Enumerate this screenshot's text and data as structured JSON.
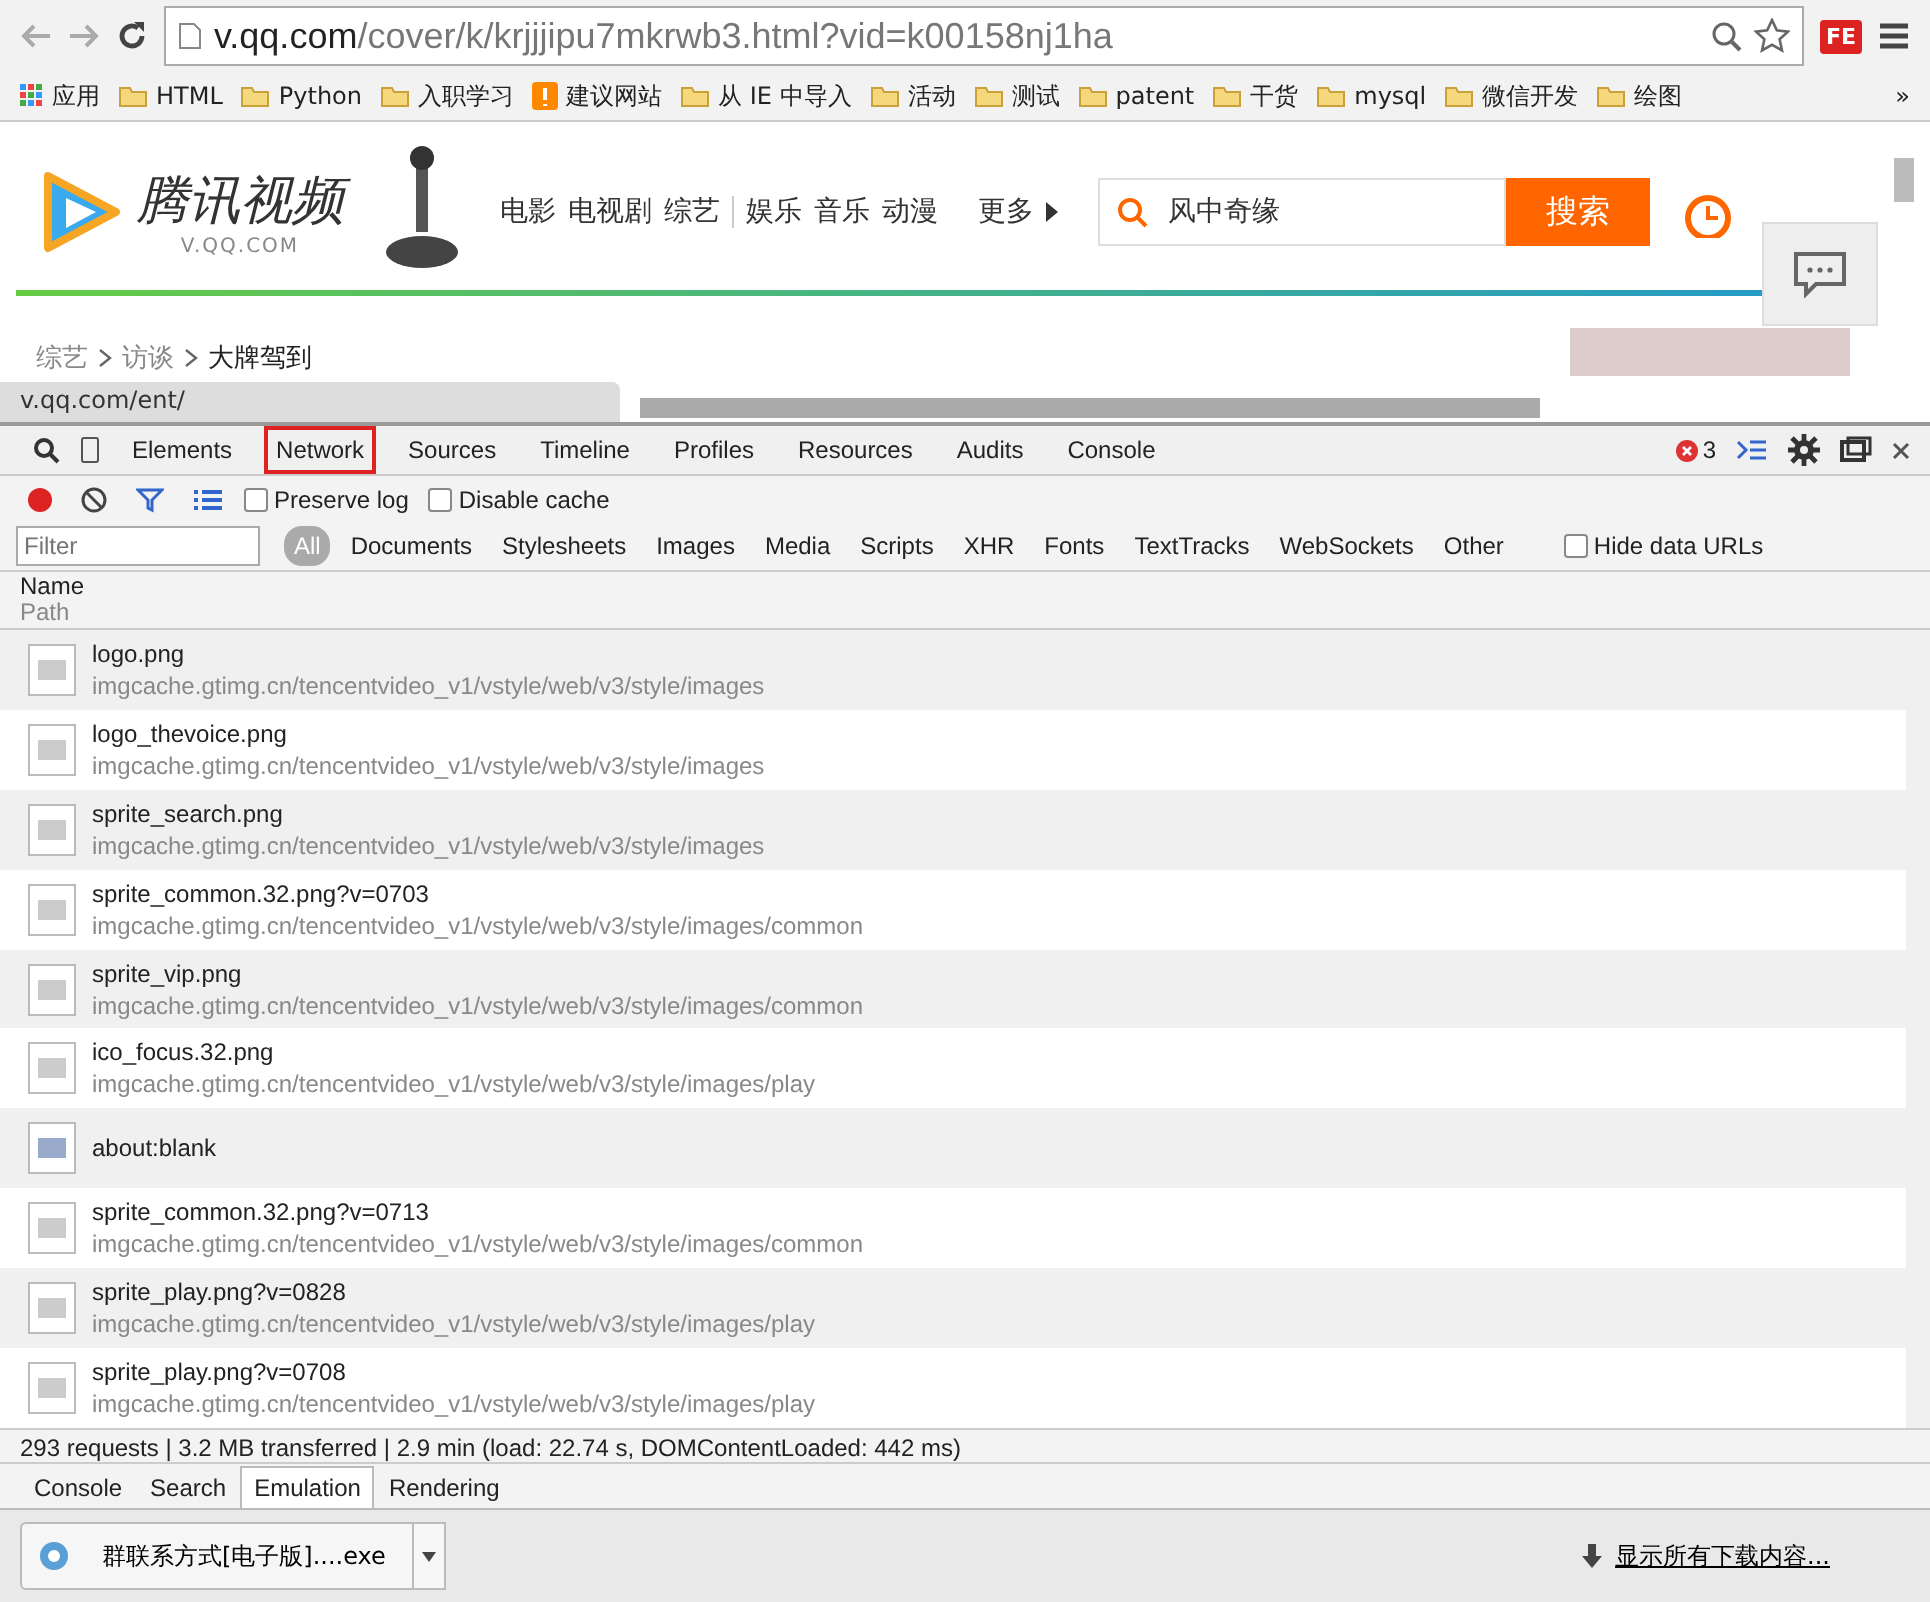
{
  "browser": {
    "url_host": "v.qq.com",
    "url_path": "/cover/k/krjjjipu7mkrwb3.html?vid=k00158nj1ha",
    "extension": "FE"
  },
  "bookmarks": [
    {
      "label": "应用",
      "kind": "apps"
    },
    {
      "label": "HTML",
      "kind": "folder"
    },
    {
      "label": "Python",
      "kind": "folder"
    },
    {
      "label": "入职学习",
      "kind": "folder"
    },
    {
      "label": "建议网站",
      "kind": "site"
    },
    {
      "label": "从 IE 中导入",
      "kind": "folder"
    },
    {
      "label": "活动",
      "kind": "folder"
    },
    {
      "label": "测试",
      "kind": "folder"
    },
    {
      "label": "patent",
      "kind": "folder"
    },
    {
      "label": "干货",
      "kind": "folder"
    },
    {
      "label": "mysql",
      "kind": "folder"
    },
    {
      "label": "微信开发",
      "kind": "folder"
    },
    {
      "label": "绘图",
      "kind": "folder"
    }
  ],
  "bookmarks_more": "»",
  "page": {
    "logo_title": "腾讯视频",
    "logo_sub": "V.QQ.COM",
    "nav": [
      {
        "label": "电影",
        "divider_after": false
      },
      {
        "label": "电视剧",
        "divider_after": false
      },
      {
        "label": "综艺",
        "divider_after": true
      },
      {
        "label": "娱乐",
        "divider_after": false
      },
      {
        "label": "音乐",
        "divider_after": false
      },
      {
        "label": "动漫",
        "divider_after": false
      }
    ],
    "more": "更多",
    "search_value": "风中奇缘",
    "search_button": "搜索",
    "breadcrumb": [
      "综艺",
      "访谈",
      "大牌驾到"
    ],
    "status_url": "v.qq.com/ent/"
  },
  "devtools": {
    "tabs": [
      {
        "label": "Elements",
        "selected": false
      },
      {
        "label": "Network",
        "selected": true
      },
      {
        "label": "Sources",
        "selected": false
      },
      {
        "label": "Timeline",
        "selected": false
      },
      {
        "label": "Profiles",
        "selected": false
      },
      {
        "label": "Resources",
        "selected": false
      },
      {
        "label": "Audits",
        "selected": false
      },
      {
        "label": "Console",
        "selected": false
      }
    ],
    "error_count": "3",
    "recording": true,
    "preserve_log": {
      "label": "Preserve log",
      "checked": false
    },
    "disable_cache": {
      "label": "Disable cache",
      "checked": false
    },
    "filter_placeholder": "Filter",
    "types": [
      {
        "label": "All",
        "selected": true
      },
      {
        "label": "Documents",
        "selected": false
      },
      {
        "label": "Stylesheets",
        "selected": false
      },
      {
        "label": "Images",
        "selected": false
      },
      {
        "label": "Media",
        "selected": false
      },
      {
        "label": "Scripts",
        "selected": false
      },
      {
        "label": "XHR",
        "selected": false
      },
      {
        "label": "Fonts",
        "selected": false
      },
      {
        "label": "TextTracks",
        "selected": false
      },
      {
        "label": "WebSockets",
        "selected": false
      },
      {
        "label": "Other",
        "selected": false
      }
    ],
    "hide_data_urls": {
      "label": "Hide data URLs",
      "checked": false
    },
    "column_name": "Name",
    "column_path": "Path",
    "rows": [
      {
        "name": "logo.png",
        "path": "imgcache.gtimg.cn/tencentvideo_v1/vstyle/web/v3/style/images"
      },
      {
        "name": "logo_thevoice.png",
        "path": "imgcache.gtimg.cn/tencentvideo_v1/vstyle/web/v3/style/images"
      },
      {
        "name": "sprite_search.png",
        "path": "imgcache.gtimg.cn/tencentvideo_v1/vstyle/web/v3/style/images"
      },
      {
        "name": "sprite_common.32.png?v=0703",
        "path": "imgcache.gtimg.cn/tencentvideo_v1/vstyle/web/v3/style/images/common"
      },
      {
        "name": "sprite_vip.png",
        "path": "imgcache.gtimg.cn/tencentvideo_v1/vstyle/web/v3/style/images/common"
      },
      {
        "name": "ico_focus.32.png",
        "path": "imgcache.gtimg.cn/tencentvideo_v1/vstyle/web/v3/style/images/play"
      },
      {
        "name": "about:blank"
      },
      {
        "name": "sprite_common.32.png?v=0713",
        "path": "imgcache.gtimg.cn/tencentvideo_v1/vstyle/web/v3/style/images/common"
      },
      {
        "name": "sprite_play.png?v=0828",
        "path": "imgcache.gtimg.cn/tencentvideo_v1/vstyle/web/v3/style/images/play"
      },
      {
        "name": "sprite_play.png?v=0708",
        "path": "imgcache.gtimg.cn/tencentvideo_v1/vstyle/web/v3/style/images/play"
      }
    ],
    "summary": "293 requests | 3.2 MB transferred | 2.9 min (load: 22.74 s, DOMContentLoaded: 442 ms)",
    "drawer_tabs": [
      {
        "label": "Console",
        "selected": false
      },
      {
        "label": "Search",
        "selected": false
      },
      {
        "label": "Emulation",
        "selected": true
      },
      {
        "label": "Rendering",
        "selected": false
      }
    ]
  },
  "downloads": {
    "file": "群联系方式[电子版]....exe",
    "show_all": "显示所有下载内容..."
  }
}
